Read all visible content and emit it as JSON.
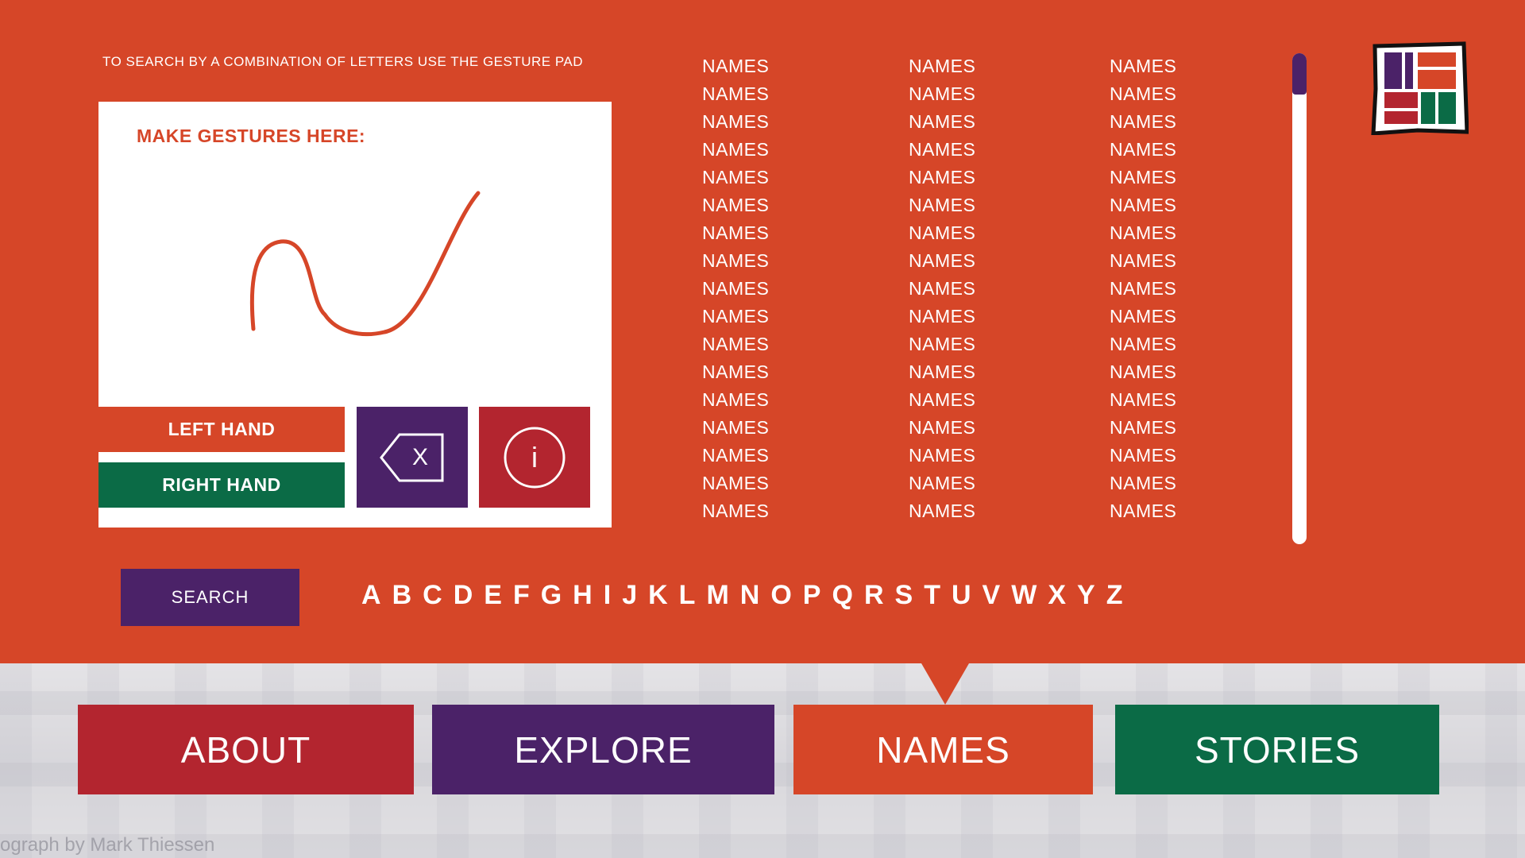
{
  "instructions": "TO SEARCH BY A COMBINATION OF LETTERS USE THE GESTURE PAD",
  "gesture_pad": {
    "title": "MAKE GESTURES HERE:",
    "left_hand": "LEFT HAND",
    "right_hand": "RIGHT HAND",
    "backspace_icon": "backspace-x-icon",
    "backspace_label": "X",
    "info_icon": "info-icon",
    "info_label": "i"
  },
  "names": {
    "columns": [
      [
        "NAMES",
        "NAMES",
        "NAMES",
        "NAMES",
        "NAMES",
        "NAMES",
        "NAMES",
        "NAMES",
        "NAMES",
        "NAMES",
        "NAMES",
        "NAMES",
        "NAMES",
        "NAMES",
        "NAMES",
        "NAMES",
        "NAMES"
      ],
      [
        "NAMES",
        "NAMES",
        "NAMES",
        "NAMES",
        "NAMES",
        "NAMES",
        "NAMES",
        "NAMES",
        "NAMES",
        "NAMES",
        "NAMES",
        "NAMES",
        "NAMES",
        "NAMES",
        "NAMES",
        "NAMES",
        "NAMES"
      ],
      [
        "NAMES",
        "NAMES",
        "NAMES",
        "NAMES",
        "NAMES",
        "NAMES",
        "NAMES",
        "NAMES",
        "NAMES",
        "NAMES",
        "NAMES",
        "NAMES",
        "NAMES",
        "NAMES",
        "NAMES",
        "NAMES",
        "NAMES"
      ]
    ]
  },
  "search_label": "SEARCH",
  "alphabet": [
    "A",
    "B",
    "C",
    "D",
    "E",
    "F",
    "G",
    "H",
    "I",
    "J",
    "K",
    "L",
    "M",
    "N",
    "O",
    "P",
    "Q",
    "R",
    "S",
    "T",
    "U",
    "V",
    "W",
    "X",
    "Y",
    "Z"
  ],
  "nav": {
    "about": "ABOUT",
    "explore": "EXPLORE",
    "names": "NAMES",
    "stories": "STORIES"
  },
  "credit": "otograph by Mark Thiessen",
  "colors": {
    "background": "#d64628",
    "purple": "#4b2268",
    "red": "#b3252f",
    "green": "#0b6b46",
    "orange": "#d64628"
  }
}
